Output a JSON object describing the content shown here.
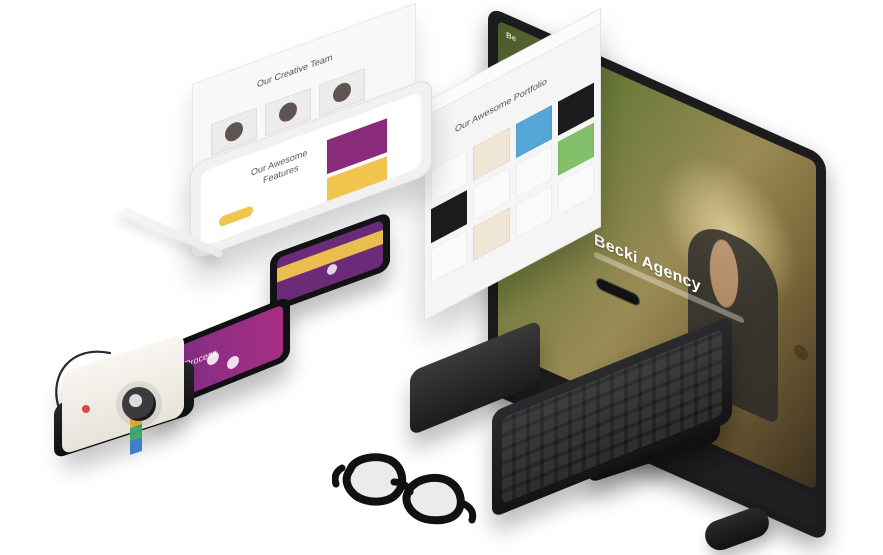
{
  "panels": {
    "team_title": "Our Creative Team",
    "features_title": "Our Awesome",
    "features_subtitle": "Features",
    "portfolio_title": "Our Awesome Portfolio"
  },
  "imac": {
    "nav_logo": "Be",
    "hero_title": "Becki Agency"
  },
  "phones": {
    "purple_label": "Our Process"
  },
  "colors": {
    "accent_purple": "#7c2e86",
    "accent_yellow": "#f1c54d",
    "device_dark": "#1c1c1e"
  },
  "icons": [
    "apple-logo-icon"
  ]
}
